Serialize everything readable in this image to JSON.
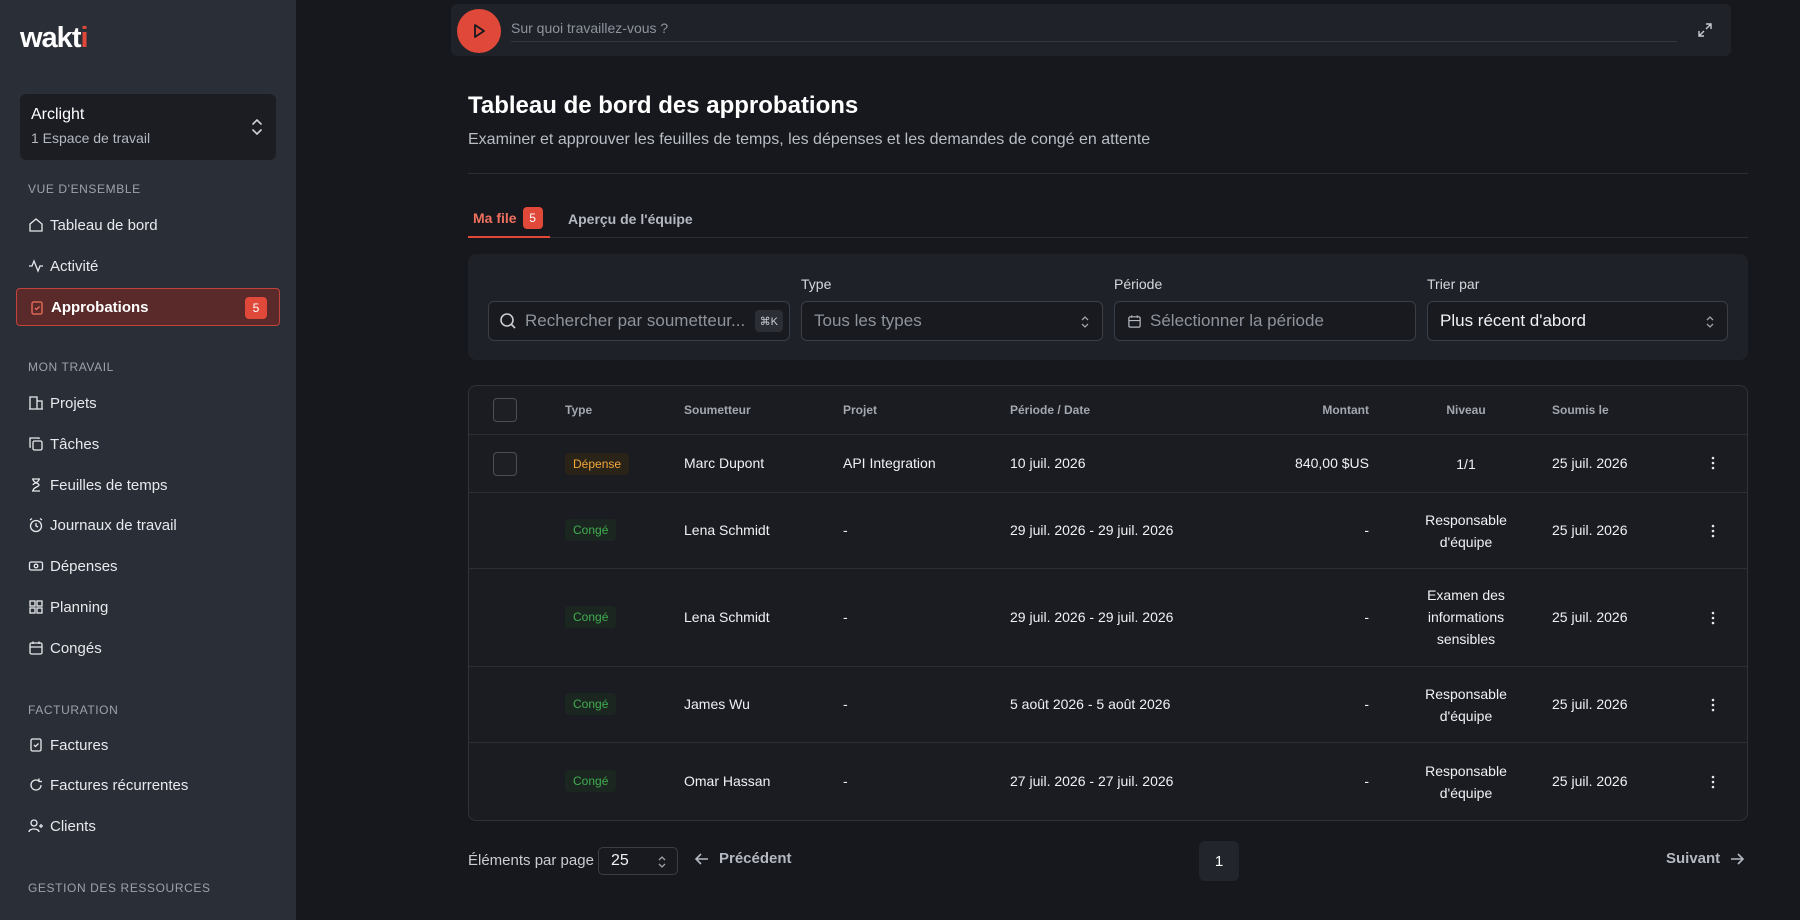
{
  "brand": {
    "logo_text": "wakti",
    "accent": "#e0483a"
  },
  "workspace": {
    "name": "Arclight",
    "subtitle": "1 Espace de travail"
  },
  "sidebar": {
    "sections": [
      {
        "title": "VUE D'ENSEMBLE"
      },
      {
        "title": "MON TRAVAIL"
      },
      {
        "title": "FACTURATION"
      },
      {
        "title": "GESTION DES RESSOURCES"
      }
    ],
    "items": [
      {
        "label": "Tableau de bord",
        "icon": "home-icon"
      },
      {
        "label": "Activité",
        "icon": "activity-icon"
      },
      {
        "label": "Approbations",
        "icon": "clipboard-check-icon",
        "badge": "5",
        "active": true
      },
      {
        "label": "Projets",
        "icon": "building-icon"
      },
      {
        "label": "Tâches",
        "icon": "copy-icon"
      },
      {
        "label": "Feuilles de temps",
        "icon": "hourglass-icon"
      },
      {
        "label": "Journaux de travail",
        "icon": "alarm-clock-icon"
      },
      {
        "label": "Dépenses",
        "icon": "banknote-icon"
      },
      {
        "label": "Planning",
        "icon": "grid-icon"
      },
      {
        "label": "Congés",
        "icon": "calendar-icon"
      },
      {
        "label": "Factures",
        "icon": "receipt-check-icon"
      },
      {
        "label": "Factures récurrentes",
        "icon": "refresh-icon"
      },
      {
        "label": "Clients",
        "icon": "user-plus-icon"
      }
    ]
  },
  "timer": {
    "placeholder": "Sur quoi travaillez-vous ?"
  },
  "header": {
    "title": "Tableau de bord des approbations",
    "subtitle": "Examiner et approuver les feuilles de temps, les dépenses et les demandes de congé en attente"
  },
  "tabs": [
    {
      "label": "Ma file",
      "badge": "5",
      "active": true
    },
    {
      "label": "Aperçu de l'équipe",
      "active": false
    }
  ],
  "filters": {
    "search_placeholder": "Rechercher par soumetteur...",
    "shortcut": "⌘K",
    "type_label": "Type",
    "type_value": "Tous les types",
    "period_label": "Période",
    "period_placeholder": "Sélectionner la période",
    "sort_label": "Trier par",
    "sort_value": "Plus récent d'abord"
  },
  "table": {
    "columns": [
      "Type",
      "Soumetteur",
      "Projet",
      "Période / Date",
      "Montant",
      "Niveau",
      "Soumis le"
    ],
    "rows": [
      {
        "type": "Dépense",
        "type_kind": "expense",
        "submitter": "Marc Dupont",
        "project": "API Integration",
        "period": "10 juil. 2026",
        "amount": "840,00 $US",
        "level": "1/1",
        "submitted": "25 juil. 2026",
        "checkbox": true
      },
      {
        "type": "Congé",
        "type_kind": "leave",
        "submitter": "Lena Schmidt",
        "project": "-",
        "period": "29 juil. 2026 - 29 juil. 2026",
        "amount": "-",
        "level": "Responsable d'équipe",
        "submitted": "25 juil. 2026",
        "checkbox": false
      },
      {
        "type": "Congé",
        "type_kind": "leave",
        "submitter": "Lena Schmidt",
        "project": "-",
        "period": "29 juil. 2026 - 29 juil. 2026",
        "amount": "-",
        "level": "Examen des informations sensibles",
        "submitted": "25 juil. 2026",
        "checkbox": false
      },
      {
        "type": "Congé",
        "type_kind": "leave",
        "submitter": "James Wu",
        "project": "-",
        "period": "5 août 2026 - 5 août 2026",
        "amount": "-",
        "level": "Responsable d'équipe",
        "submitted": "25 juil. 2026",
        "checkbox": false
      },
      {
        "type": "Congé",
        "type_kind": "leave",
        "submitter": "Omar Hassan",
        "project": "-",
        "period": "27 juil. 2026 - 27 juil. 2026",
        "amount": "-",
        "level": "Responsable d'équipe",
        "submitted": "25 juil. 2026",
        "checkbox": false
      }
    ]
  },
  "pagination": {
    "per_page_label": "Éléments par page",
    "per_page": "25",
    "prev": "Précédent",
    "page": "1",
    "next": "Suivant"
  }
}
